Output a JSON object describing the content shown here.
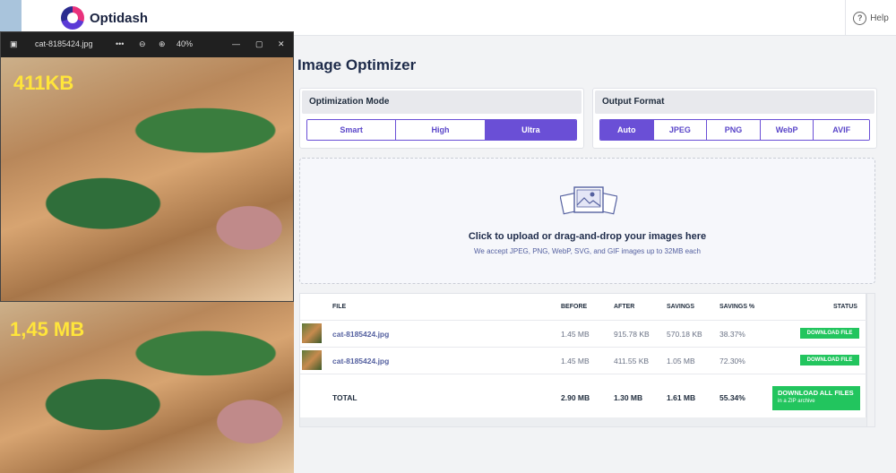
{
  "app": {
    "name": "Optidash",
    "help_label": "Help"
  },
  "page": {
    "title": "Image Optimizer"
  },
  "optimization": {
    "heading": "Optimization Mode",
    "options": [
      "Smart",
      "High",
      "Ultra"
    ],
    "selected": "Ultra"
  },
  "format": {
    "heading": "Output Format",
    "options": [
      "Auto",
      "JPEG",
      "PNG",
      "WebP",
      "AVIF"
    ],
    "selected": "Auto"
  },
  "upload": {
    "title": "Click to upload or drag-and-drop your images here",
    "subtitle": "We accept JPEG, PNG, WebP, SVG, and GIF images up to 32MB each"
  },
  "table": {
    "headers": {
      "file": "FILE",
      "before": "BEFORE",
      "after": "AFTER",
      "savings": "SAVINGS",
      "savings_pct": "SAVINGS %",
      "status": "STATUS"
    },
    "rows": [
      {
        "file": "cat-8185424.jpg",
        "before": "1.45 MB",
        "after": "915.78 KB",
        "savings": "570.18 KB",
        "savings_pct": "38.37%",
        "action": "DOWNLOAD FILE"
      },
      {
        "file": "cat-8185424.jpg",
        "before": "1.45 MB",
        "after": "411.55 KB",
        "savings": "1.05 MB",
        "savings_pct": "72.30%",
        "action": "DOWNLOAD FILE"
      }
    ],
    "total": {
      "label": "TOTAL",
      "before": "2.90 MB",
      "after": "1.30 MB",
      "savings": "1.61 MB",
      "savings_pct": "55.34%",
      "action": "DOWNLOAD ALL FILES",
      "action_sub": "in a ZIP archive"
    }
  },
  "viewer": {
    "filename": "cat-8185424.jpg",
    "more": "•••",
    "zoom": "40%",
    "top_label": "411KB",
    "bottom_label": "1,45 MB"
  },
  "colors": {
    "accent": "#6a4fd6",
    "success": "#22c55e",
    "label": "#ffe53b"
  }
}
